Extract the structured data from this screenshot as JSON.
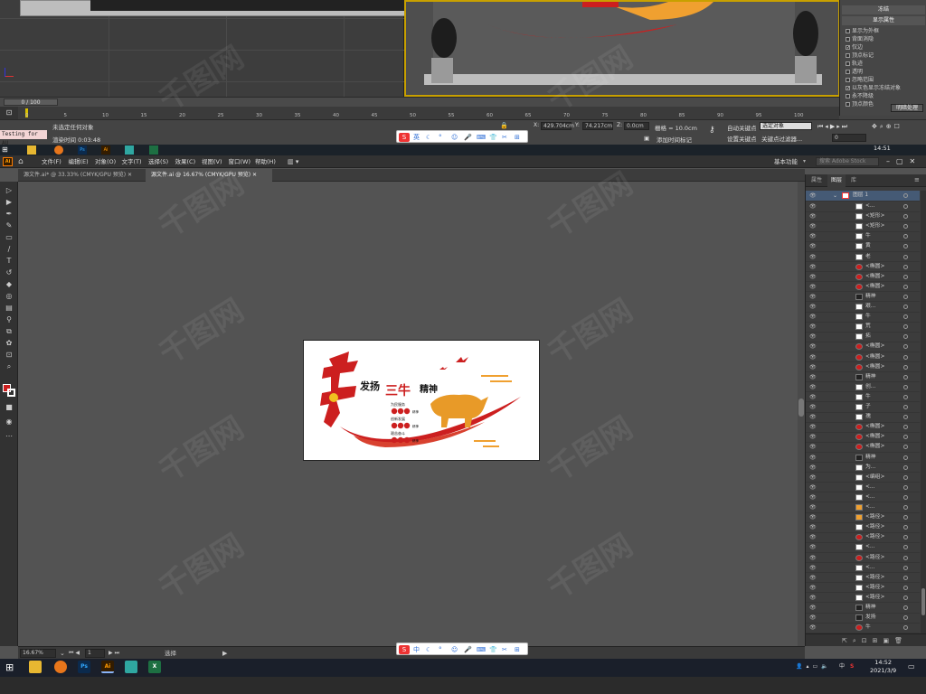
{
  "max": {
    "frame_counter": "0 / 100",
    "status_selection": "未选定任何对象",
    "render_time": "渲染时间 0:03:48",
    "testing_label": "Testing for AU",
    "coord_x": "429.704cm",
    "coord_y": "74.217cm",
    "coord_z": "0.0cm",
    "grid": "栅格 = 10.0cm",
    "auto_key": "自动关键点",
    "set_key": "设置关键点",
    "selected_dropdown": "选定对象",
    "key_filters": "关键点过滤器...",
    "add_time_tag": "添加时间标记",
    "timeline_ticks": [
      "0",
      "5",
      "10",
      "15",
      "20",
      "25",
      "30",
      "35",
      "40",
      "45",
      "50",
      "55",
      "60",
      "65",
      "70",
      "75",
      "80",
      "85",
      "90",
      "95",
      "100"
    ],
    "cmd_panel": {
      "title": "冻结",
      "section": "显示属性",
      "items": [
        {
          "label": "显示为外框",
          "checked": false
        },
        {
          "label": "背面消隐",
          "checked": false
        },
        {
          "label": "仅边",
          "checked": true
        },
        {
          "label": "顶点标记",
          "checked": false
        },
        {
          "label": "轨迹",
          "checked": false
        },
        {
          "label": "透明",
          "checked": false
        },
        {
          "label": "忽略范围",
          "checked": false
        },
        {
          "label": "以灰色显示冻结对象",
          "checked": true
        },
        {
          "label": "永不降级",
          "checked": false
        },
        {
          "label": "顶点颜色",
          "checked": false
        }
      ],
      "shade_button": "明暗处理"
    },
    "frame_field": "0"
  },
  "taskbar_top": {
    "time": "14:51"
  },
  "ai": {
    "menus": [
      "文件(F)",
      "编辑(E)",
      "对象(O)",
      "文字(T)",
      "选择(S)",
      "效果(C)",
      "视图(V)",
      "窗口(W)",
      "帮助(H)"
    ],
    "workspace": "基本功能",
    "search_placeholder": "搜索 Adobe Stock",
    "tabs": [
      {
        "label": "源文件.ai* @ 33.33% (CMYK/GPU 预览)",
        "active": false
      },
      {
        "label": "源文件.ai @ 16.67% (CMYK/GPU 预览)",
        "active": true
      }
    ],
    "panel_tabs": [
      "属性",
      "图层",
      "库"
    ],
    "layer_top": "图层 1",
    "layers": [
      {
        "name": "<...",
        "thumb": "#ffffff"
      },
      {
        "name": "<矩形>",
        "thumb": "#ffffff"
      },
      {
        "name": "<矩形>",
        "thumb": "#ffffff"
      },
      {
        "name": "牛",
        "thumb": "#ffffff"
      },
      {
        "name": "黄",
        "thumb": "#ffffff"
      },
      {
        "name": "老",
        "thumb": "#ffffff"
      },
      {
        "name": "<椭圆>",
        "thumb": "#cc1f1f"
      },
      {
        "name": "<椭圆>",
        "thumb": "#cc1f1f"
      },
      {
        "name": "<椭圆>",
        "thumb": "#cc1f1f"
      },
      {
        "name": "精神",
        "thumb": "#222222"
      },
      {
        "name": "艰...",
        "thumb": "#ffffff"
      },
      {
        "name": "牛",
        "thumb": "#ffffff"
      },
      {
        "name": "荒",
        "thumb": "#ffffff"
      },
      {
        "name": "拓",
        "thumb": "#ffffff"
      },
      {
        "name": "<椭圆>",
        "thumb": "#cc1f1f"
      },
      {
        "name": "<椭圆>",
        "thumb": "#cc1f1f"
      },
      {
        "name": "<椭圆>",
        "thumb": "#cc1f1f"
      },
      {
        "name": "精神",
        "thumb": "#222222"
      },
      {
        "name": "创...",
        "thumb": "#ffffff"
      },
      {
        "name": "牛",
        "thumb": "#ffffff"
      },
      {
        "name": "子",
        "thumb": "#ffffff"
      },
      {
        "name": "孺",
        "thumb": "#ffffff"
      },
      {
        "name": "<椭圆>",
        "thumb": "#cc1f1f"
      },
      {
        "name": "<椭圆>",
        "thumb": "#cc1f1f"
      },
      {
        "name": "<椭圆>",
        "thumb": "#cc1f1f"
      },
      {
        "name": "精神",
        "thumb": "#222222"
      },
      {
        "name": "为...",
        "thumb": "#ffffff"
      },
      {
        "name": "<编组>",
        "thumb": "#ffffff"
      },
      {
        "name": "<...",
        "thumb": "#ffffff"
      },
      {
        "name": "<...",
        "thumb": "#ffffff"
      },
      {
        "name": "<...",
        "thumb": "#f0a030"
      },
      {
        "name": "<路径>",
        "thumb": "#f0a030"
      },
      {
        "name": "<路径>",
        "thumb": "#ffffff"
      },
      {
        "name": "<路径>",
        "thumb": "#cc1f1f"
      },
      {
        "name": "<...",
        "thumb": "#ffffff"
      },
      {
        "name": "<路径>",
        "thumb": "#cc1f1f"
      },
      {
        "name": "<...",
        "thumb": "#ffffff"
      },
      {
        "name": "<路径>",
        "thumb": "#ffffff"
      },
      {
        "name": "<路径>",
        "thumb": "#ffffff"
      },
      {
        "name": "<路径>",
        "thumb": "#ffffff"
      },
      {
        "name": "精神",
        "thumb": "#222222"
      },
      {
        "name": "发扬",
        "thumb": "#222222"
      },
      {
        "name": "牛",
        "thumb": "#cc1f1f"
      },
      {
        "name": "三",
        "thumb": "#cc1f1f"
      }
    ],
    "zoom": "16.67%",
    "page": "1",
    "status_text": "选择",
    "artwork": {
      "title_left": "发扬",
      "title_red": "三牛",
      "title_right": "精神",
      "row_labels": [
        "为民服务",
        "创新发展",
        "艰苦奋斗"
      ],
      "row_tags": [
        "孺子牛",
        "拓荒牛",
        "老黄牛"
      ],
      "row_word": "精神"
    }
  },
  "taskbar_bottom": {
    "time": "14:52",
    "date": "2021/3/9",
    "lang": "中"
  },
  "ime": {
    "items_top": [
      "英",
      "°",
      "☺",
      "🎤",
      "⌨",
      "👕",
      "✂",
      "⊞"
    ],
    "items_bottom": [
      "中",
      "°",
      "☺",
      "🎤",
      "⌨",
      "👕",
      "✂",
      "⊞"
    ]
  },
  "colors": {
    "accent_red": "#cc1f1f",
    "accent_orange": "#f0a030",
    "ai_orange": "#ff7c00"
  },
  "watermark": "千图网"
}
